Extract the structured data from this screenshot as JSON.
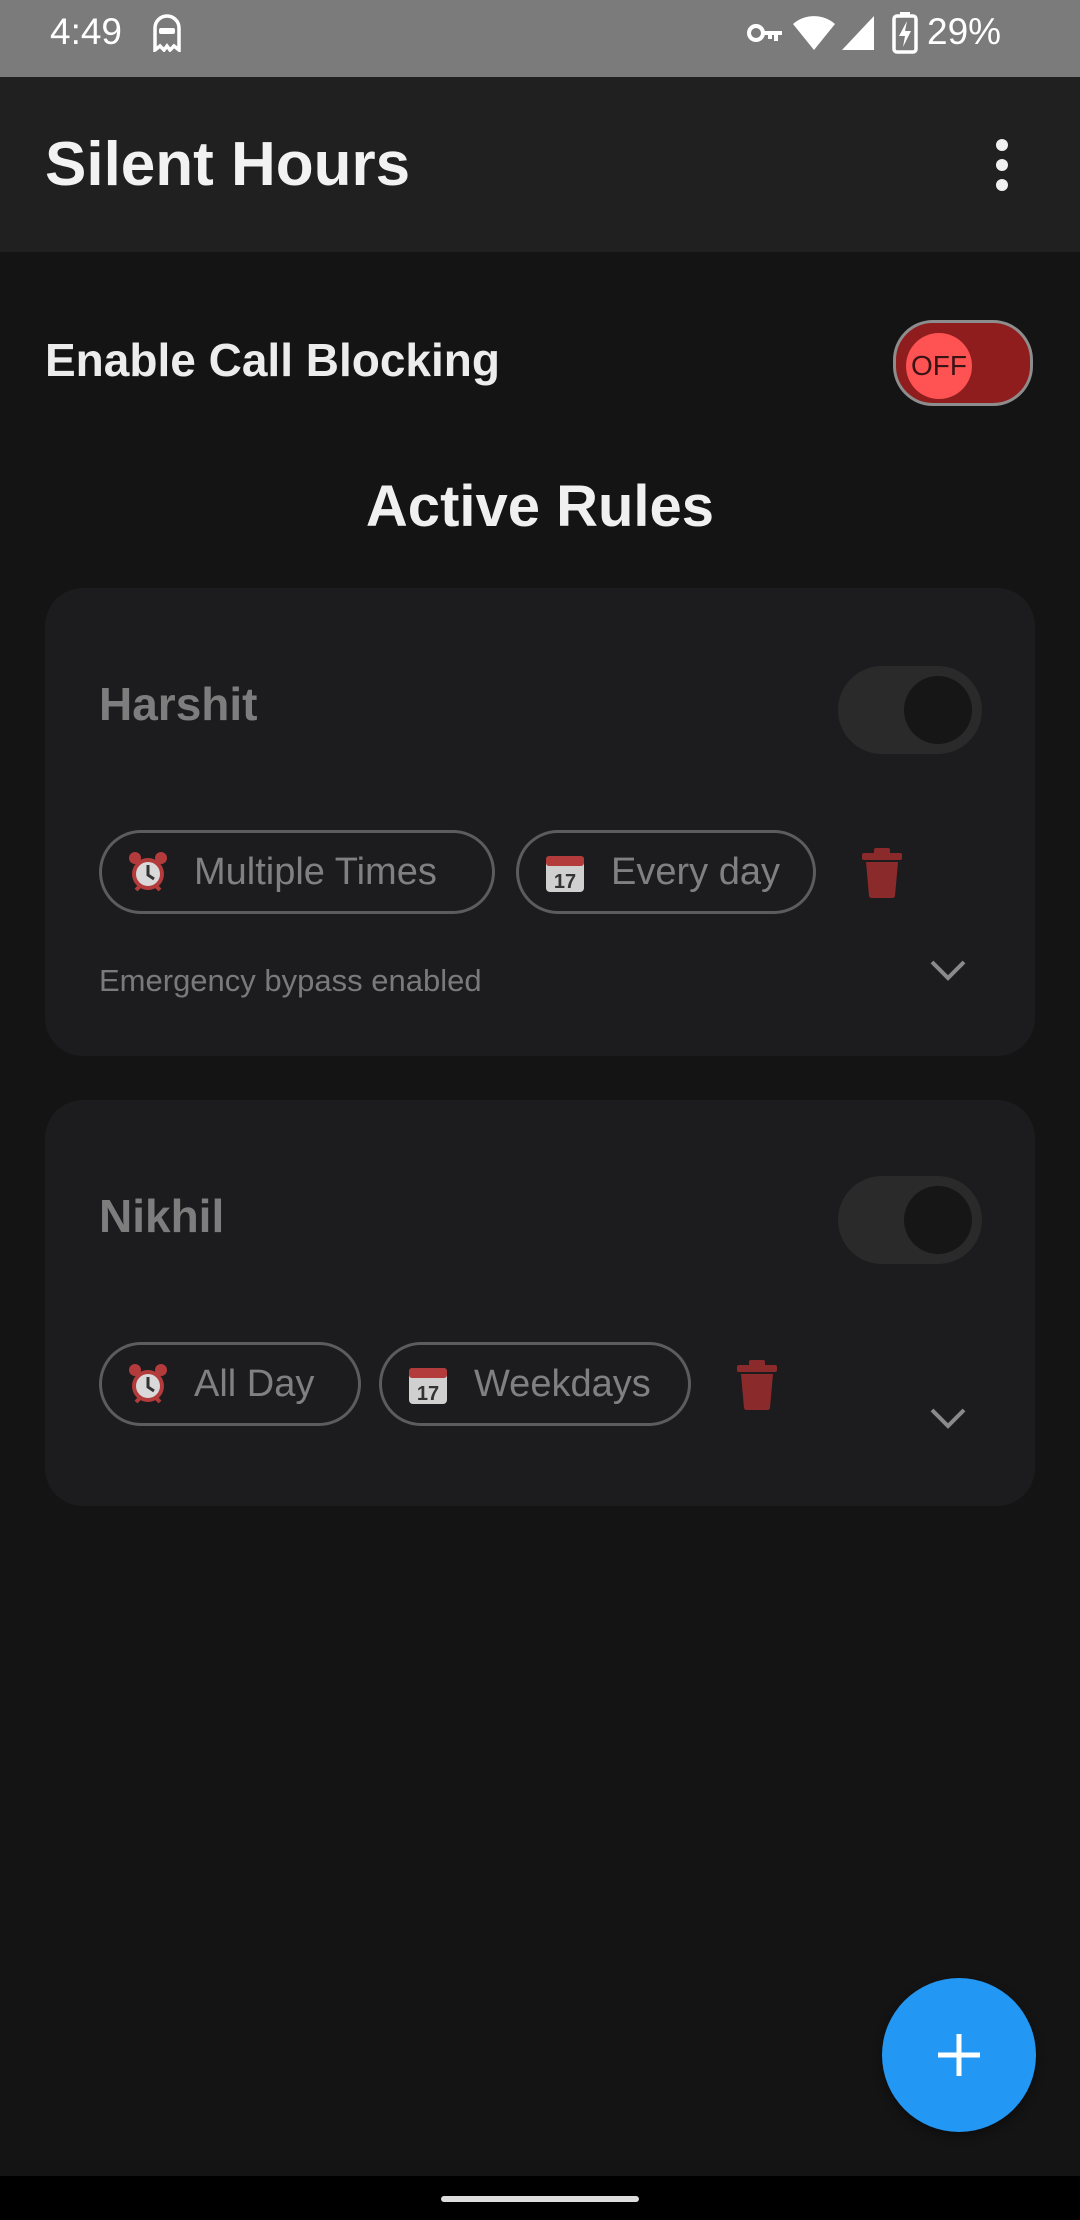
{
  "status_bar": {
    "time": "4:49",
    "battery_percent": "29%",
    "icons": [
      "ghost-icon",
      "vpn-key-icon",
      "wifi-icon",
      "cellular-signal-icon",
      "battery-charging-icon"
    ]
  },
  "app_bar": {
    "title": "Silent Hours",
    "menu_icon": "more-vert-icon"
  },
  "call_blocking": {
    "label": "Enable Call Blocking",
    "toggle_text": "OFF",
    "enabled": false
  },
  "rules_section": {
    "title": "Active Rules"
  },
  "rules": [
    {
      "name": "Harshit",
      "enabled": false,
      "time_chip": "Multiple Times",
      "day_chip": "Every day",
      "note": "Emergency bypass enabled"
    },
    {
      "name": "Nikhil",
      "enabled": false,
      "time_chip": "All Day",
      "day_chip": "Weekdays"
    }
  ],
  "fab": {
    "icon": "plus-icon"
  },
  "colors": {
    "background": "#141415",
    "card": "#1c1c1e",
    "accent": "#2297f3",
    "toggle_off_track": "#8f1d1d",
    "toggle_off_thumb": "#fe5253",
    "delete": "#8b2a2a"
  }
}
